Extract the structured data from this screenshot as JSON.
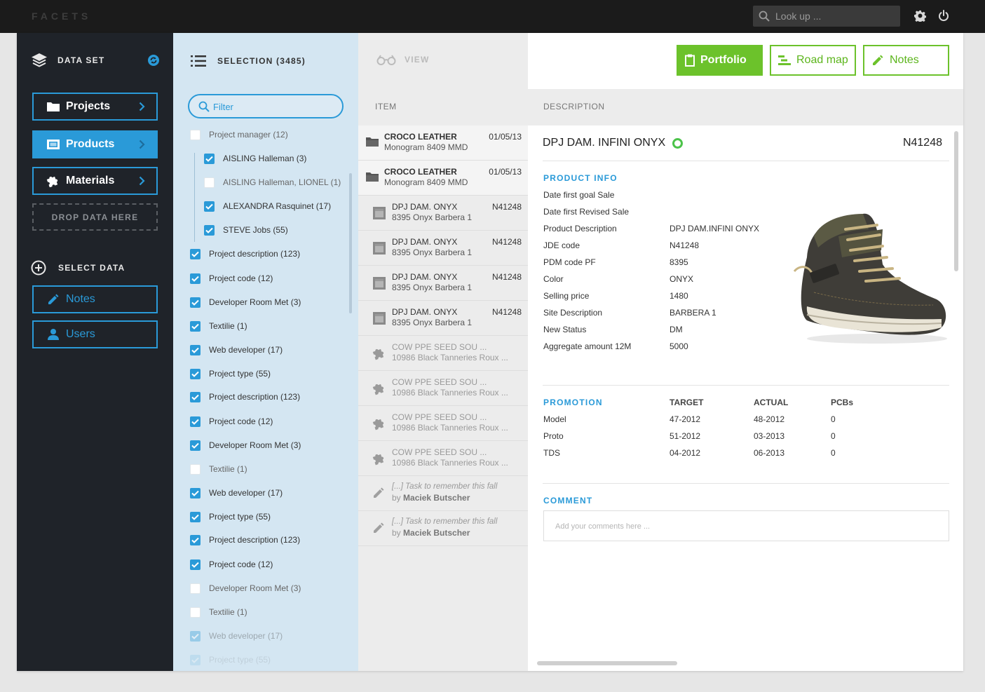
{
  "app": {
    "logo": "FACETS"
  },
  "topbar": {
    "search_placeholder": "Look up ..."
  },
  "dataset": {
    "title": "DATA SET",
    "buttons": [
      {
        "label": "Projects",
        "icon": "folder-icon",
        "active": false
      },
      {
        "label": "Products",
        "icon": "product-icon",
        "active": true
      },
      {
        "label": "Materials",
        "icon": "puzzle-icon",
        "active": false
      }
    ],
    "drop_label": "DROP DATA HERE",
    "select_title": "SELECT DATA",
    "select_buttons": [
      {
        "label": "Notes",
        "icon": "pencil-icon"
      },
      {
        "label": "Users",
        "icon": "user-icon"
      }
    ]
  },
  "selection": {
    "title": "SELECTION (3485)",
    "filter_placeholder": "Filter",
    "items": [
      {
        "label": "Project manager (12)",
        "checked": false,
        "indent": 0
      },
      {
        "label": "AISLING Halleman (3)",
        "checked": true,
        "indent": 1
      },
      {
        "label": "AISLING Halleman, LIONEL (1)",
        "checked": false,
        "indent": 1
      },
      {
        "label": "ALEXANDRA Rasquinet (17)",
        "checked": true,
        "indent": 1
      },
      {
        "label": "STEVE Jobs (55)",
        "checked": true,
        "indent": 1
      },
      {
        "label": "Project description (123)",
        "checked": true,
        "indent": 0
      },
      {
        "label": "Project code (12)",
        "checked": true,
        "indent": 0
      },
      {
        "label": "Developer Room Met (3)",
        "checked": true,
        "indent": 0
      },
      {
        "label": "Textilie (1)",
        "checked": true,
        "indent": 0
      },
      {
        "label": "Web developer (17)",
        "checked": true,
        "indent": 0
      },
      {
        "label": "Project type (55)",
        "checked": true,
        "indent": 0
      },
      {
        "label": "Project description (123)",
        "checked": true,
        "indent": 0
      },
      {
        "label": "Project code (12)",
        "checked": true,
        "indent": 0
      },
      {
        "label": "Developer Room Met (3)",
        "checked": true,
        "indent": 0
      },
      {
        "label": "Textilie (1)",
        "checked": false,
        "indent": 0
      },
      {
        "label": "Web developer (17)",
        "checked": true,
        "indent": 0
      },
      {
        "label": "Project type (55)",
        "checked": true,
        "indent": 0
      },
      {
        "label": "Project description (123)",
        "checked": true,
        "indent": 0
      },
      {
        "label": "Project code (12)",
        "checked": true,
        "indent": 0
      },
      {
        "label": "Developer Room Met (3)",
        "checked": false,
        "indent": 0
      },
      {
        "label": "Textilie (1)",
        "checked": false,
        "indent": 0
      },
      {
        "label": "Web developer (17)",
        "checked": true,
        "indent": 0
      },
      {
        "label": "Project type (55)",
        "checked": true,
        "indent": 0
      }
    ]
  },
  "list": {
    "view_label": "VIEW",
    "col_item": "ITEM",
    "items": [
      {
        "kind": "folder",
        "title": "CROCO LEATHER",
        "sub": "Monogram 8409 MMD",
        "code": "01/05/13"
      },
      {
        "kind": "folder",
        "title": "CROCO LEATHER",
        "sub": "Monogram 8409 MMD",
        "code": "01/05/13"
      },
      {
        "kind": "doc",
        "title": "DPJ DAM. ONYX",
        "sub": "8395 Onyx Barbera 1",
        "code": "N41248"
      },
      {
        "kind": "doc",
        "title": "DPJ DAM. ONYX",
        "sub": "8395 Onyx Barbera 1",
        "code": "N41248"
      },
      {
        "kind": "doc",
        "title": "DPJ DAM. ONYX",
        "sub": "8395 Onyx Barbera 1",
        "code": "N41248"
      },
      {
        "kind": "doc",
        "title": "DPJ DAM. ONYX",
        "sub": "8395 Onyx Barbera 1",
        "code": "N41248"
      },
      {
        "kind": "gray",
        "title": "COW PPE SEED SOU ...",
        "sub": "10986 Black Tanneries Roux ...",
        "code": ""
      },
      {
        "kind": "gray",
        "title": "COW PPE SEED SOU ...",
        "sub": "10986 Black Tanneries Roux ...",
        "code": ""
      },
      {
        "kind": "gray",
        "title": "COW PPE SEED SOU ...",
        "sub": "10986 Black Tanneries Roux ...",
        "code": ""
      },
      {
        "kind": "gray",
        "title": "COW PPE SEED SOU ...",
        "sub": "10986 Black Tanneries Roux ...",
        "code": ""
      },
      {
        "kind": "note",
        "title": "[...] Task to remember this fall",
        "sub_prefix": "by",
        "author": "Maciek Butscher",
        "code": ""
      },
      {
        "kind": "note",
        "title": "[...] Task to remember this fall",
        "sub_prefix": "by",
        "author": "Maciek Butscher",
        "code": ""
      }
    ]
  },
  "detail": {
    "buttons": {
      "portfolio": "Portfolio",
      "roadmap": "Road map",
      "notes": "Notes"
    },
    "col_description": "DESCRIPTION",
    "title": "DPJ DAM. INFINI ONYX",
    "code": "N41248",
    "product_info_title": "PRODUCT INFO",
    "product_info": [
      {
        "key": "Date first goal Sale",
        "value": ""
      },
      {
        "key": "Date first Revised Sale",
        "value": ""
      },
      {
        "key": "Product Description",
        "value": "DPJ DAM.INFINI ONYX"
      },
      {
        "key": "JDE code",
        "value": "N41248"
      },
      {
        "key": "PDM code PF",
        "value": "8395"
      },
      {
        "key": "Color",
        "value": "ONYX"
      },
      {
        "key": "Selling price",
        "value": "1480"
      },
      {
        "key": "Site Description",
        "value": "BARBERA 1"
      },
      {
        "key": "New Status",
        "value": "DM"
      },
      {
        "key": "Aggregate amount 12M",
        "value": "5000"
      }
    ],
    "promotion": {
      "title": "PROMOTION",
      "headers": [
        "TARGET",
        "ACTUAL",
        "PCBs"
      ],
      "rows": [
        {
          "name": "Model",
          "target": "47-2012",
          "actual": "48-2012",
          "pcbs": "0"
        },
        {
          "name": "Proto",
          "target": "51-2012",
          "actual": "03-2013",
          "pcbs": "0"
        },
        {
          "name": "TDS",
          "target": "04-2012",
          "actual": "06-2013",
          "pcbs": "0"
        }
      ]
    },
    "comment_title": "COMMENT",
    "comment_placeholder": "Add your comments here ..."
  },
  "colors": {
    "accent_blue": "#2a9ad8",
    "accent_green": "#6cc22b",
    "dark_panel": "#1f2329",
    "selection_bg": "#d4e6f2"
  }
}
